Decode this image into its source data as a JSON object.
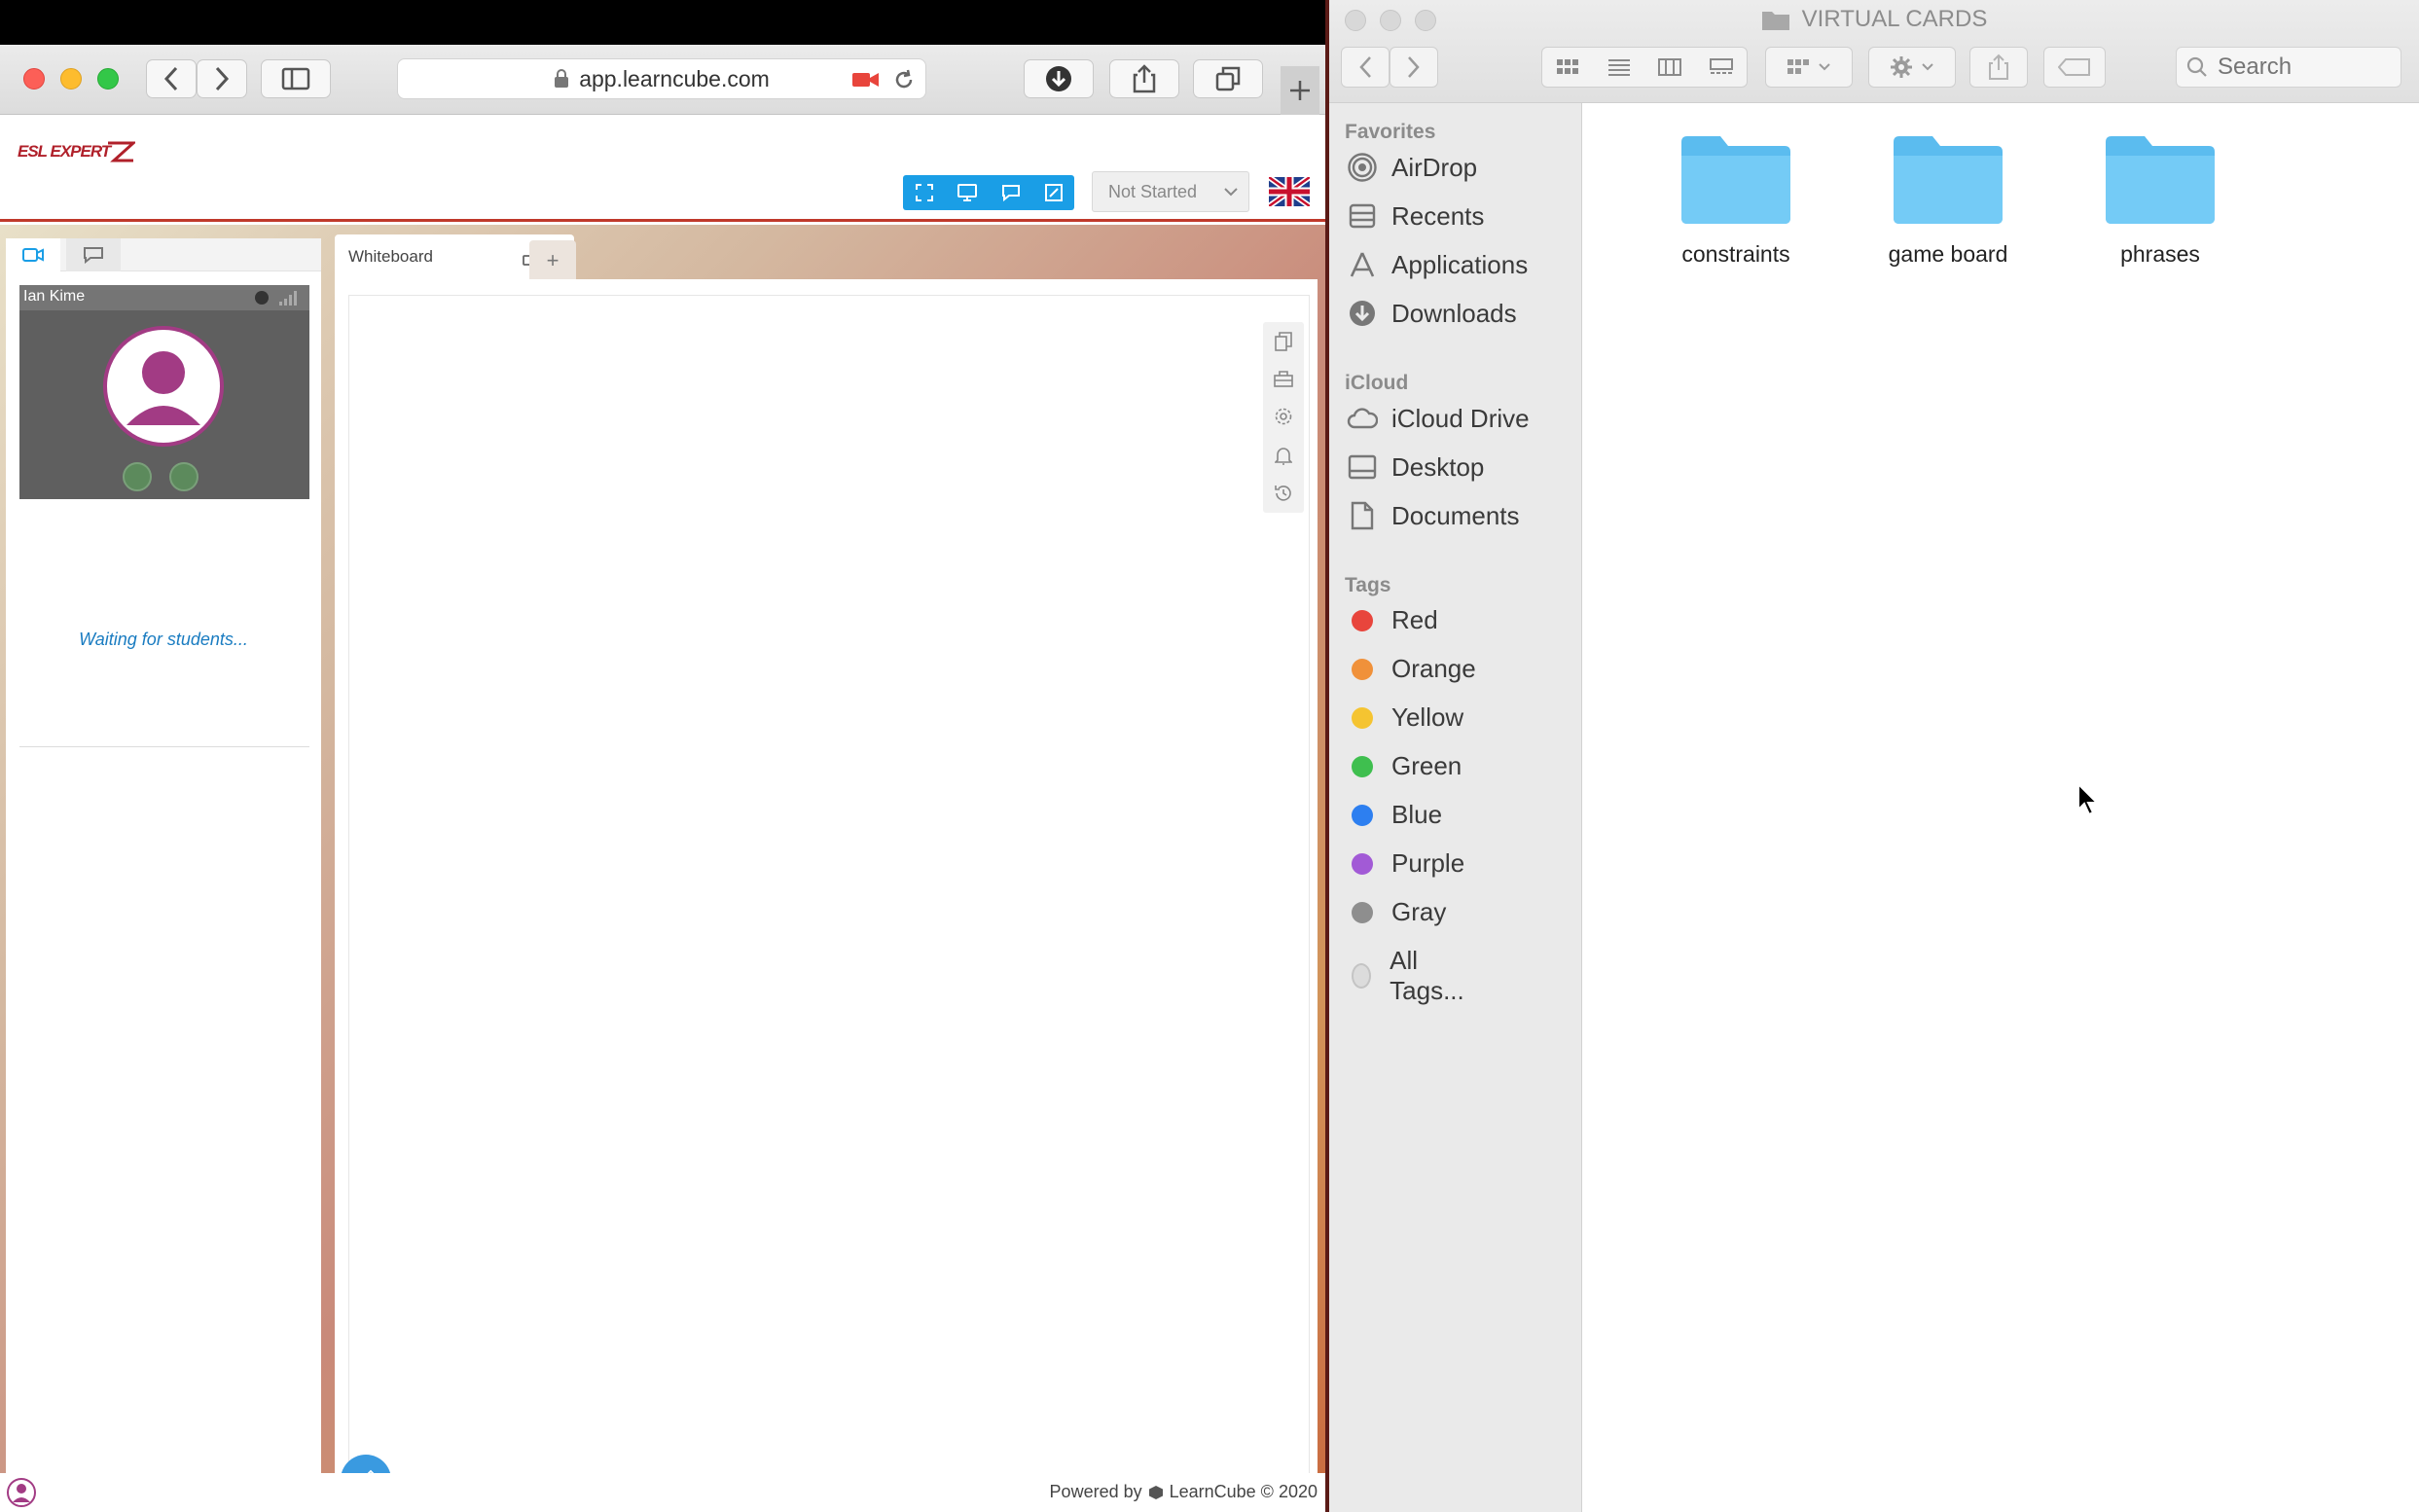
{
  "safari": {
    "url": "app.learncube.com"
  },
  "learncube": {
    "logo_text": "ESL EXPERT",
    "status_select": "Not Started",
    "tabs": [
      {
        "label": "Whiteboard"
      }
    ],
    "add_tab": "+",
    "participant": {
      "name": "Ian Kime"
    },
    "waiting_text": "Waiting for students...",
    "footer_prefix": "Powered by",
    "footer_brand": "LearnCube © 2020"
  },
  "finder": {
    "title": "VIRTUAL CARDS",
    "search_placeholder": "Search",
    "sidebar": {
      "favorites_header": "Favorites",
      "favorites": [
        {
          "label": "AirDrop",
          "icon": "airdrop-icon"
        },
        {
          "label": "Recents",
          "icon": "recents-icon"
        },
        {
          "label": "Applications",
          "icon": "applications-icon"
        },
        {
          "label": "Downloads",
          "icon": "downloads-icon"
        }
      ],
      "icloud_header": "iCloud",
      "icloud": [
        {
          "label": "iCloud Drive",
          "icon": "cloud-icon"
        },
        {
          "label": "Desktop",
          "icon": "desktop-icon"
        },
        {
          "label": "Documents",
          "icon": "document-icon"
        }
      ],
      "tags_header": "Tags",
      "tags": [
        {
          "label": "Red",
          "color": "#e8453c"
        },
        {
          "label": "Orange",
          "color": "#f0913a"
        },
        {
          "label": "Yellow",
          "color": "#f5c431"
        },
        {
          "label": "Green",
          "color": "#3fbf4f"
        },
        {
          "label": "Blue",
          "color": "#2d7ff0"
        },
        {
          "label": "Purple",
          "color": "#a25ad6"
        },
        {
          "label": "Gray",
          "color": "#8e8e8e"
        },
        {
          "label": "All Tags...",
          "color": "#dcdcdc"
        }
      ]
    },
    "folders": [
      {
        "label": "constraints"
      },
      {
        "label": "game board"
      },
      {
        "label": "phrases"
      }
    ]
  },
  "colors": {
    "accent_blue": "#1a9ee6",
    "folder_blue": "#66c7f4",
    "brand_red": "#c0392b"
  }
}
